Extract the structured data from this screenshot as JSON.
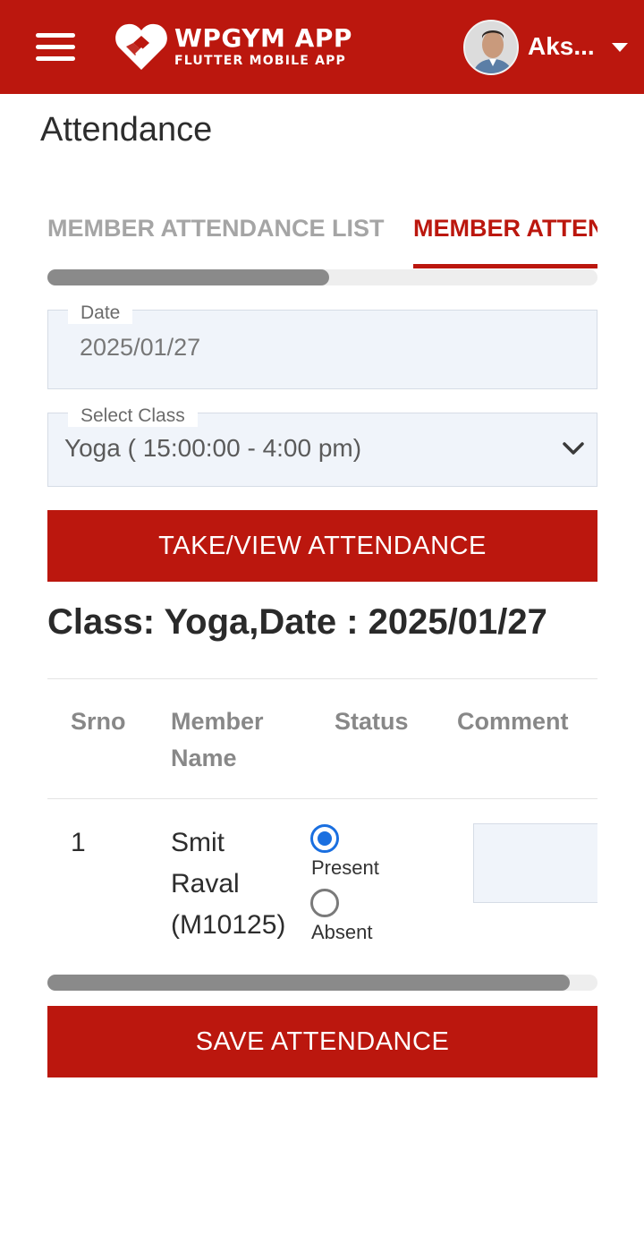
{
  "header": {
    "brand_title": "WPGYM APP",
    "brand_subtitle": "FLUTTER MOBILE APP",
    "user_name": "Aks...",
    "bar_color": "#bb170e"
  },
  "page": {
    "title": "Attendance"
  },
  "tabs": [
    {
      "label": "MEMBER ATTENDANCE LIST",
      "active": false
    },
    {
      "label": "MEMBER ATTENDANCE",
      "active": true
    }
  ],
  "scroll": {
    "tabs_position": 0.51,
    "table_position": 0.95
  },
  "form": {
    "date_label": "Date",
    "date_value": "2025/01/27",
    "class_label": "Select Class",
    "class_value": "Yoga ( 15:00:00 - 4:00 pm)",
    "take_button": "TAKE/VIEW ATTENDANCE"
  },
  "summary": {
    "heading": "Class: Yoga,Date : 2025/01/27"
  },
  "table": {
    "headers": {
      "srno": "Srno",
      "member_line1": "Member",
      "member_line2": "Name",
      "status": "Status",
      "comment": "Comment"
    },
    "rows": [
      {
        "srno": "1",
        "name_line1": "Smit",
        "name_line2": "Raval",
        "name_line3": "(M10125)",
        "present_label": "Present",
        "absent_label": "Absent",
        "status": "Present",
        "comment": ""
      }
    ]
  },
  "save_button": "SAVE ATTENDANCE"
}
